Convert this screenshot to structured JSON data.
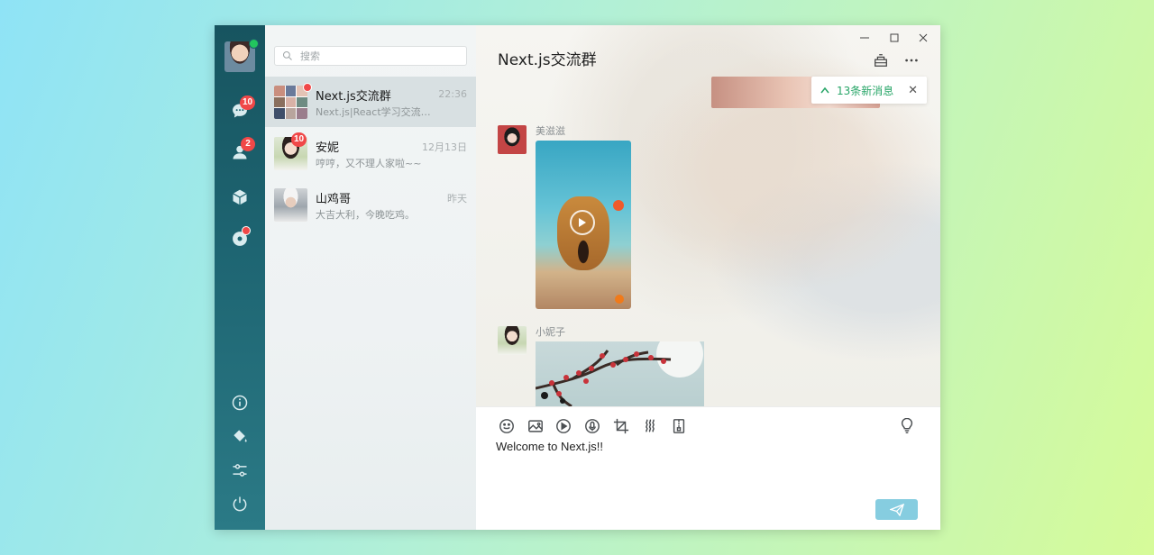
{
  "search": {
    "placeholder": "搜索"
  },
  "rail": {
    "chats_badge": "10",
    "contacts_badge": "2"
  },
  "contacts": [
    {
      "name": "Next.js交流群",
      "time": "22:36",
      "last_message": "Next.js|React学习交流分...",
      "unread_dot": true
    },
    {
      "name": "安妮",
      "time": "12月13日",
      "last_message": "哼哼，又不理人家啦~~",
      "unread_badge": "10"
    },
    {
      "name": "山鸡哥",
      "time": "昨天",
      "last_message": "大吉大利，今晚吃鸡。"
    }
  ],
  "chat": {
    "title": "Next.js交流群",
    "new_messages": "13条新消息",
    "messages": [
      {
        "sender": "美滋滋",
        "type": "video"
      },
      {
        "sender": "小妮子",
        "type": "image"
      }
    ]
  },
  "composer": {
    "text": "Welcome to Next.js!!"
  },
  "colors": {
    "rail": "#1e6572",
    "accent_green": "#27a567",
    "badge_red": "#f04848",
    "send_button": "#86cde0"
  }
}
